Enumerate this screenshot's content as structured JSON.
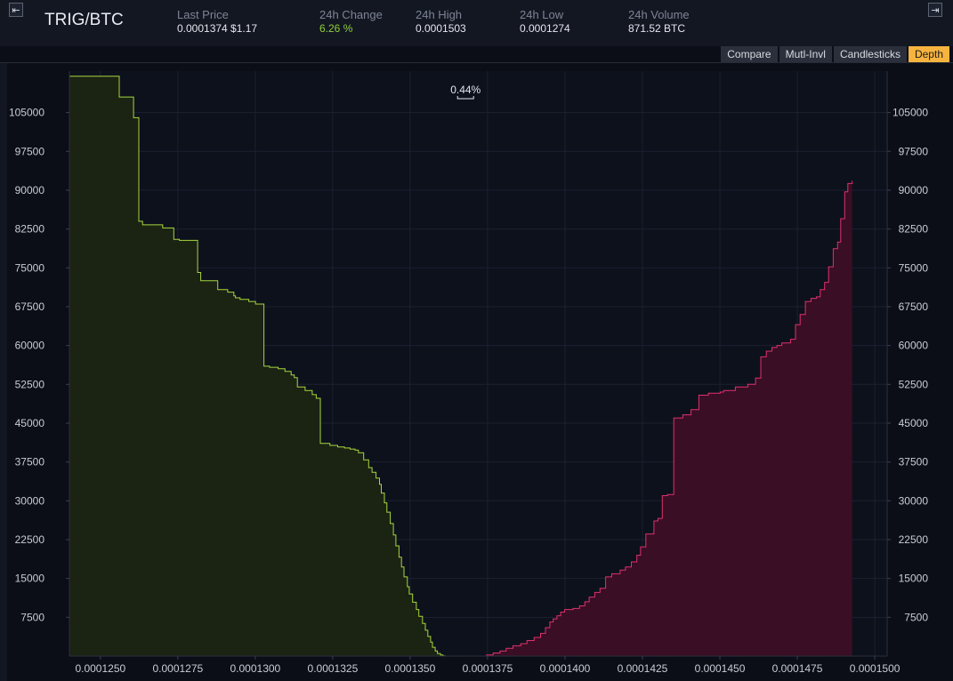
{
  "header": {
    "pair": "TRIG/BTC",
    "left_icon": "collapse-left-icon",
    "right_icon": "collapse-right-icon",
    "stats": [
      {
        "label": "Last Price",
        "value": "0.0001374 $1.17",
        "tone": "normal"
      },
      {
        "label": "24h Change",
        "value": "6.26 %",
        "tone": "green"
      },
      {
        "label": "24h High",
        "value": "0.0001503",
        "tone": "normal"
      },
      {
        "label": "24h Low",
        "value": "0.0001274",
        "tone": "normal"
      },
      {
        "label": "24h Volume",
        "value": "871.52 BTC",
        "tone": "normal"
      }
    ]
  },
  "tabs": [
    {
      "label": "Compare",
      "active": false
    },
    {
      "label": "Mutl-Invl",
      "active": false
    },
    {
      "label": "Candlesticks",
      "active": false
    },
    {
      "label": "Depth",
      "active": true
    }
  ],
  "colors": {
    "bid_line": "#a7d63d",
    "bid_fill": "#1b2313",
    "ask_line": "#e0306e",
    "ask_fill": "#3a0e24",
    "grid": "#1c2130",
    "tick_text": "#c8ccd4"
  },
  "chart_data": {
    "type": "area",
    "spread_label": "0.44%",
    "xlim": [
      0.000124,
      0.0001504
    ],
    "ylim": [
      0,
      113000
    ],
    "x_ticks": [
      "0.0001250",
      "0.0001275",
      "0.0001300",
      "0.0001325",
      "0.0001350",
      "0.0001375",
      "0.0001400",
      "0.0001425",
      "0.0001450",
      "0.0001475",
      "0.0001500"
    ],
    "y_ticks": [
      "105000",
      "97500",
      "90000",
      "82500",
      "75000",
      "67500",
      "60000",
      "52500",
      "45000",
      "37500",
      "30000",
      "22500",
      "15000",
      "7500"
    ],
    "series": [
      {
        "side": "bid",
        "x": [
          0.00012401,
          0.00012561,
          0.00012607,
          0.00012624,
          0.00012636,
          0.00012701,
          0.00012737,
          0.00012755,
          0.00012814,
          0.00012824,
          0.00012879,
          0.00012911,
          0.00012931,
          0.00012936,
          0.00012951,
          0.00012979,
          0.00013001,
          0.00013028,
          0.00013046,
          0.00013074,
          0.00013096,
          0.00013116,
          0.00013126,
          0.00013136,
          0.00013161,
          0.00013184,
          0.00013197,
          0.0001321,
          0.00013241,
          0.00013266,
          0.00013288,
          0.00013306,
          0.00013322,
          0.00013333,
          0.0001335,
          0.00013366,
          0.00013377,
          0.0001339,
          0.00013401,
          0.00013407,
          0.00013417,
          0.00013425,
          0.00013436,
          0.00013446,
          0.00013454,
          0.00013464,
          0.00013472,
          0.0001348,
          0.00013491,
          0.00013497,
          0.00013508,
          0.0001352,
          0.00013528,
          0.0001354,
          0.00013549,
          0.00013557,
          0.00013566,
          0.00013572,
          0.00013581,
          0.00013588,
          0.00013598,
          0.00013606,
          0.00013613
        ],
        "y": [
          112000,
          108000,
          104000,
          84000,
          83300,
          82700,
          80500,
          80300,
          74100,
          72500,
          70800,
          70300,
          69600,
          69200,
          68900,
          68500,
          68000,
          56000,
          55800,
          55500,
          55000,
          54300,
          53800,
          52000,
          51300,
          50500,
          49800,
          41100,
          40700,
          40400,
          40200,
          40000,
          39800,
          39300,
          37900,
          36400,
          35500,
          34400,
          33200,
          31500,
          29600,
          27800,
          25600,
          23400,
          21300,
          19100,
          17200,
          15300,
          13400,
          12000,
          10400,
          9000,
          7700,
          6300,
          5000,
          3800,
          2700,
          1700,
          1000,
          500,
          200,
          60,
          0
        ]
      },
      {
        "side": "ask",
        "x": [
          0.00013745,
          0.00013768,
          0.0001379,
          0.0001381,
          0.00013832,
          0.00013857,
          0.00013877,
          0.000139,
          0.00013921,
          0.00013937,
          0.00013951,
          0.00013962,
          0.00013974,
          0.00013986,
          0.00013999,
          0.00014026,
          0.00014047,
          0.00014064,
          0.00014078,
          0.00014096,
          0.00014113,
          0.00014131,
          0.00014151,
          0.00014178,
          0.00014195,
          0.00014214,
          0.00014232,
          0.00014244,
          0.00014261,
          0.00014287,
          0.000143,
          0.00014314,
          0.00014331,
          0.00014351,
          0.0001438,
          0.00014407,
          0.00014432,
          0.00014463,
          0.00014501,
          0.00014512,
          0.0001455,
          0.0001459,
          0.00014615,
          0.00014632,
          0.0001465,
          0.00014668,
          0.00014684,
          0.000147,
          0.00014728,
          0.00014744,
          0.00014759,
          0.00014776,
          0.00014794,
          0.00014812,
          0.00014824,
          0.00014838,
          0.00014851,
          0.00014866,
          0.0001488,
          0.0001489,
          0.00014903,
          0.00014913,
          0.00014927
        ],
        "y": [
          200,
          600,
          1000,
          1500,
          2000,
          2400,
          3000,
          3600,
          4400,
          5500,
          6600,
          7200,
          7800,
          8500,
          9000,
          9200,
          9700,
          10500,
          11400,
          12300,
          13100,
          15300,
          15900,
          16600,
          17200,
          18200,
          19500,
          21100,
          23600,
          26100,
          26600,
          31000,
          31200,
          46000,
          46600,
          47600,
          50400,
          50800,
          51000,
          51300,
          52000,
          52500,
          53700,
          57800,
          58900,
          59600,
          60000,
          60500,
          61200,
          64000,
          66000,
          68500,
          69100,
          69400,
          70800,
          72200,
          75200,
          78700,
          80000,
          84500,
          89700,
          91300,
          91800
        ]
      }
    ]
  }
}
